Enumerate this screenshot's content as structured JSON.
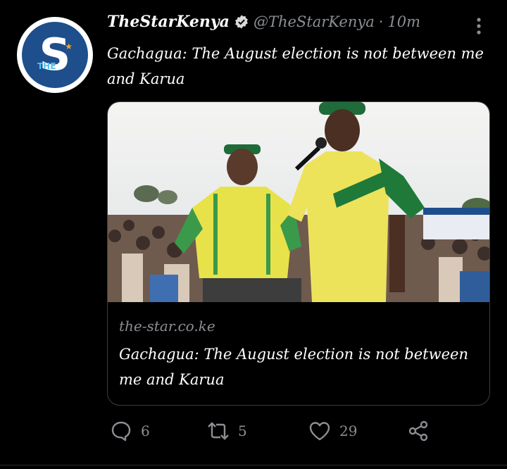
{
  "tweet": {
    "display_name": "TheStarKenya",
    "handle": "@TheStarKenya",
    "separator": "·",
    "time": "10m",
    "text": "Gachagua: The August election is not between me and Karua"
  },
  "card": {
    "domain": "the-star.co.ke",
    "title": "Gachagua: The August election is not between me and Karua"
  },
  "actions": {
    "replies": "6",
    "retweets": "5",
    "likes": "29"
  },
  "avatar": {
    "letter": "S",
    "small_text": "THE"
  },
  "colors": {
    "background": "#000000",
    "text": "#e7e9ea",
    "muted": "#8b8f94",
    "avatar_blue": "#1f4e8c"
  },
  "icons": [
    "verified-icon",
    "more-options-icon",
    "reply-icon",
    "retweet-icon",
    "like-icon",
    "share-icon"
  ]
}
